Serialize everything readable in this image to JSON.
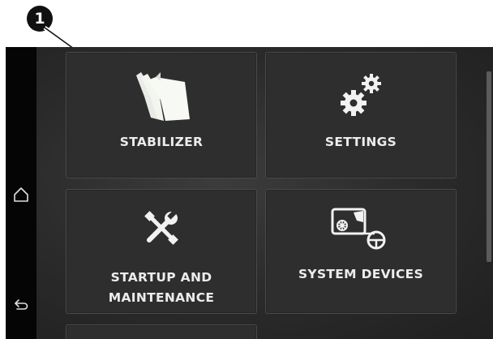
{
  "callout": {
    "number": "1"
  },
  "side_nav": {
    "home_icon": "home-icon",
    "back_icon": "back-arrow-icon"
  },
  "tiles": [
    {
      "label": "STABILIZER",
      "icon": "stabilizer-pages-icon"
    },
    {
      "label": "SETTINGS",
      "icon": "gears-icon"
    },
    {
      "label_line1": "STARTUP AND",
      "label_line2": "MAINTENANCE",
      "icon": "wrench-screwdriver-icon"
    },
    {
      "label": "SYSTEM DEVICES",
      "icon": "system-devices-icon"
    }
  ],
  "colors": {
    "screen_bg": "#2a2a2a",
    "tile_bg": "#2e2e2e",
    "text": "#ececec",
    "side_strip": "#050505"
  }
}
